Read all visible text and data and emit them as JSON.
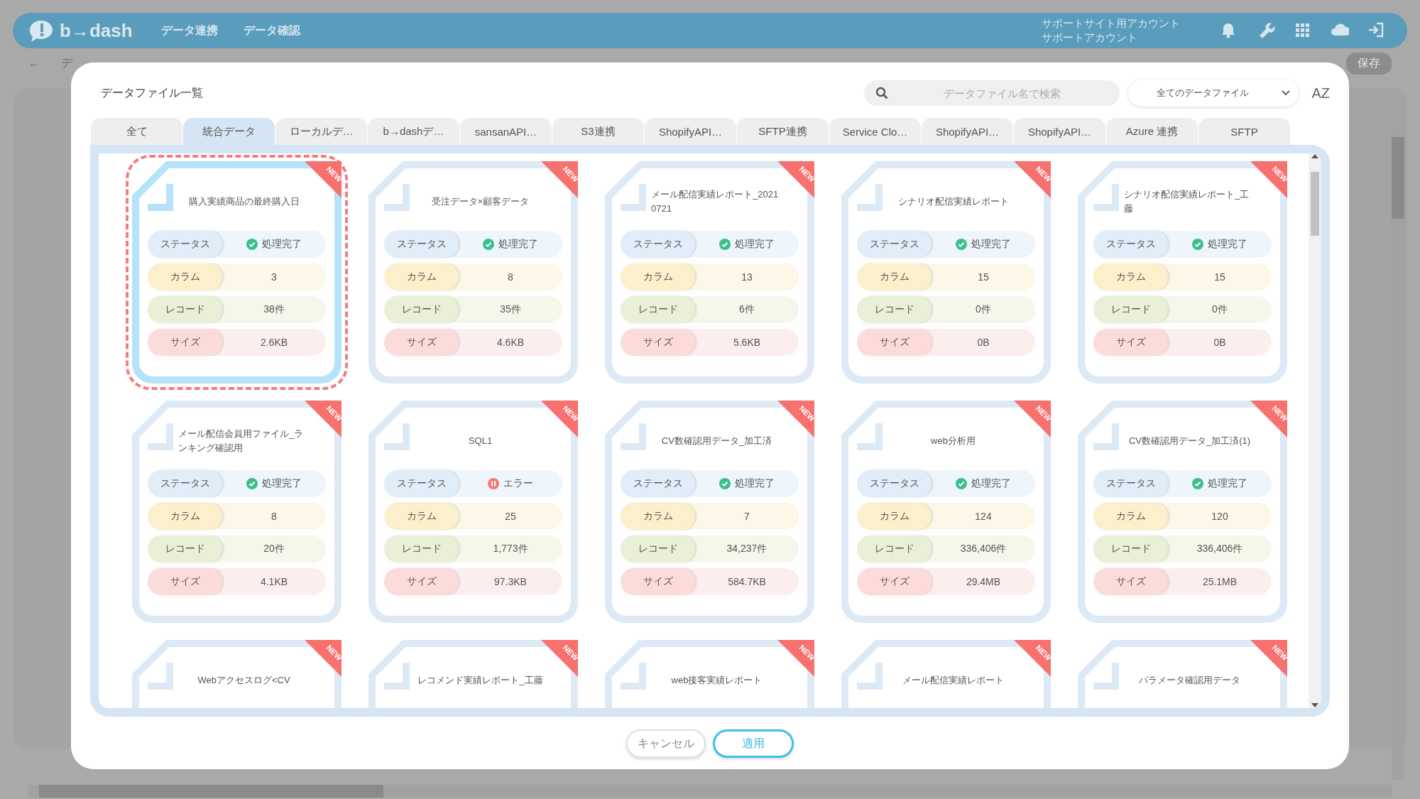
{
  "app_header": {
    "logo": "b→dash",
    "nav": [
      {
        "label": "データ連携"
      },
      {
        "label": "データ確認"
      }
    ],
    "account": [
      "サポートサイト用アカウント",
      "サポートアカウント"
    ]
  },
  "toolbar": {
    "back": "←",
    "breadcrumb": "デ",
    "save_button": "保存"
  },
  "dialog": {
    "title": "データファイル一覧",
    "search": {
      "placeholder": "データファイル名で検索"
    },
    "filter": {
      "value": "全てのデータファイル"
    },
    "sort_button": "AZ",
    "tabs": [
      {
        "label": "全て",
        "selected": false
      },
      {
        "label": "統合データ",
        "selected": true
      },
      {
        "label": "ローカルデ…",
        "selected": false
      },
      {
        "label": "b→dashデ…",
        "selected": false
      },
      {
        "label": "sansanAPI…",
        "selected": false
      },
      {
        "label": "S3連携",
        "selected": false
      },
      {
        "label": "ShopifyAPI…",
        "selected": false
      },
      {
        "label": "SFTP連携",
        "selected": false
      },
      {
        "label": "Service Clo…",
        "selected": false
      },
      {
        "label": "ShopifyAPI…",
        "selected": false
      },
      {
        "label": "ShopifyAPI…",
        "selected": false
      },
      {
        "label": "Azure 連携",
        "selected": false
      },
      {
        "label": "SFTP",
        "selected": false
      }
    ],
    "files": [
      {
        "name": "購入実績商品の最終購入日",
        "badge": "NEW",
        "selected": true,
        "fields": [
          {
            "kind": "status",
            "label": "ステータス",
            "value": "処理完了",
            "error": false
          },
          {
            "kind": "columns",
            "label": "カラム",
            "value": "3"
          },
          {
            "kind": "records",
            "label": "レコード",
            "value": "38件"
          },
          {
            "kind": "size",
            "label": "サイズ",
            "value": "2.6KB"
          }
        ]
      },
      {
        "name": "受注データ×顧客データ",
        "badge": "NEW",
        "selected": false,
        "fields": [
          {
            "kind": "status",
            "label": "ステータス",
            "value": "処理完了",
            "error": false
          },
          {
            "kind": "columns",
            "label": "カラム",
            "value": "8"
          },
          {
            "kind": "records",
            "label": "レコード",
            "value": "35件"
          },
          {
            "kind": "size",
            "label": "サイズ",
            "value": "4.6KB"
          }
        ]
      },
      {
        "name": "メール配信実績レポート_20210721",
        "badge": "NEW",
        "selected": false,
        "fields": [
          {
            "kind": "status",
            "label": "ステータス",
            "value": "処理完了",
            "error": false
          },
          {
            "kind": "columns",
            "label": "カラム",
            "value": "13"
          },
          {
            "kind": "records",
            "label": "レコード",
            "value": "6件"
          },
          {
            "kind": "size",
            "label": "サイズ",
            "value": "5.6KB"
          }
        ]
      },
      {
        "name": "シナリオ配信実績レポート",
        "badge": "NEW",
        "selected": false,
        "fields": [
          {
            "kind": "status",
            "label": "ステータス",
            "value": "処理完了",
            "error": false
          },
          {
            "kind": "columns",
            "label": "カラム",
            "value": "15"
          },
          {
            "kind": "records",
            "label": "レコード",
            "value": "0件"
          },
          {
            "kind": "size",
            "label": "サイズ",
            "value": "0B"
          }
        ]
      },
      {
        "name": "シナリオ配信実績レポート_工藤",
        "badge": "NEW",
        "selected": false,
        "fields": [
          {
            "kind": "status",
            "label": "ステータス",
            "value": "処理完了",
            "error": false
          },
          {
            "kind": "columns",
            "label": "カラム",
            "value": "15"
          },
          {
            "kind": "records",
            "label": "レコード",
            "value": "0件"
          },
          {
            "kind": "size",
            "label": "サイズ",
            "value": "0B"
          }
        ]
      },
      {
        "name": "メール配信会員用ファイル_ランキング確認用",
        "badge": "NEW",
        "selected": false,
        "fields": [
          {
            "kind": "status",
            "label": "ステータス",
            "value": "処理完了",
            "error": false
          },
          {
            "kind": "columns",
            "label": "カラム",
            "value": "8"
          },
          {
            "kind": "records",
            "label": "レコード",
            "value": "20件"
          },
          {
            "kind": "size",
            "label": "サイズ",
            "value": "4.1KB"
          }
        ]
      },
      {
        "name": "SQL1",
        "badge": "NEW",
        "selected": false,
        "fields": [
          {
            "kind": "status",
            "label": "ステータス",
            "value": "エラー",
            "error": true
          },
          {
            "kind": "columns",
            "label": "カラム",
            "value": "25"
          },
          {
            "kind": "records",
            "label": "レコード",
            "value": "1,773件"
          },
          {
            "kind": "size",
            "label": "サイズ",
            "value": "97.3KB"
          }
        ]
      },
      {
        "name": "CV数確認用データ_加工済",
        "badge": "NEW",
        "selected": false,
        "fields": [
          {
            "kind": "status",
            "label": "ステータス",
            "value": "処理完了",
            "error": false
          },
          {
            "kind": "columns",
            "label": "カラム",
            "value": "7"
          },
          {
            "kind": "records",
            "label": "レコード",
            "value": "34,237件"
          },
          {
            "kind": "size",
            "label": "サイズ",
            "value": "584.7KB"
          }
        ]
      },
      {
        "name": "web分析用",
        "badge": "NEW",
        "selected": false,
        "fields": [
          {
            "kind": "status",
            "label": "ステータス",
            "value": "処理完了",
            "error": false
          },
          {
            "kind": "columns",
            "label": "カラム",
            "value": "124"
          },
          {
            "kind": "records",
            "label": "レコード",
            "value": "336,406件"
          },
          {
            "kind": "size",
            "label": "サイズ",
            "value": "29.4MB"
          }
        ]
      },
      {
        "name": "CV数確認用データ_加工済(1)",
        "badge": "NEW",
        "selected": false,
        "fields": [
          {
            "kind": "status",
            "label": "ステータス",
            "value": "処理完了",
            "error": false
          },
          {
            "kind": "columns",
            "label": "カラム",
            "value": "120"
          },
          {
            "kind": "records",
            "label": "レコード",
            "value": "336,406件"
          },
          {
            "kind": "size",
            "label": "サイズ",
            "value": "25.1MB"
          }
        ]
      },
      {
        "name": "Webアクセスログ<CV",
        "badge": "NEW",
        "selected": false
      },
      {
        "name": "レコメンド実績レポート_工藤",
        "badge": "NEW",
        "selected": false
      },
      {
        "name": "web接客実績レポート",
        "badge": "NEW",
        "selected": false
      },
      {
        "name": "メール配信実績レポート",
        "badge": "NEW",
        "selected": false
      },
      {
        "name": "パラメータ確認用データ",
        "badge": "NEW",
        "selected": false
      }
    ],
    "buttons": [
      {
        "label": "キャンセル",
        "kind": "secondary"
      },
      {
        "label": "適用",
        "kind": "primary"
      }
    ]
  }
}
